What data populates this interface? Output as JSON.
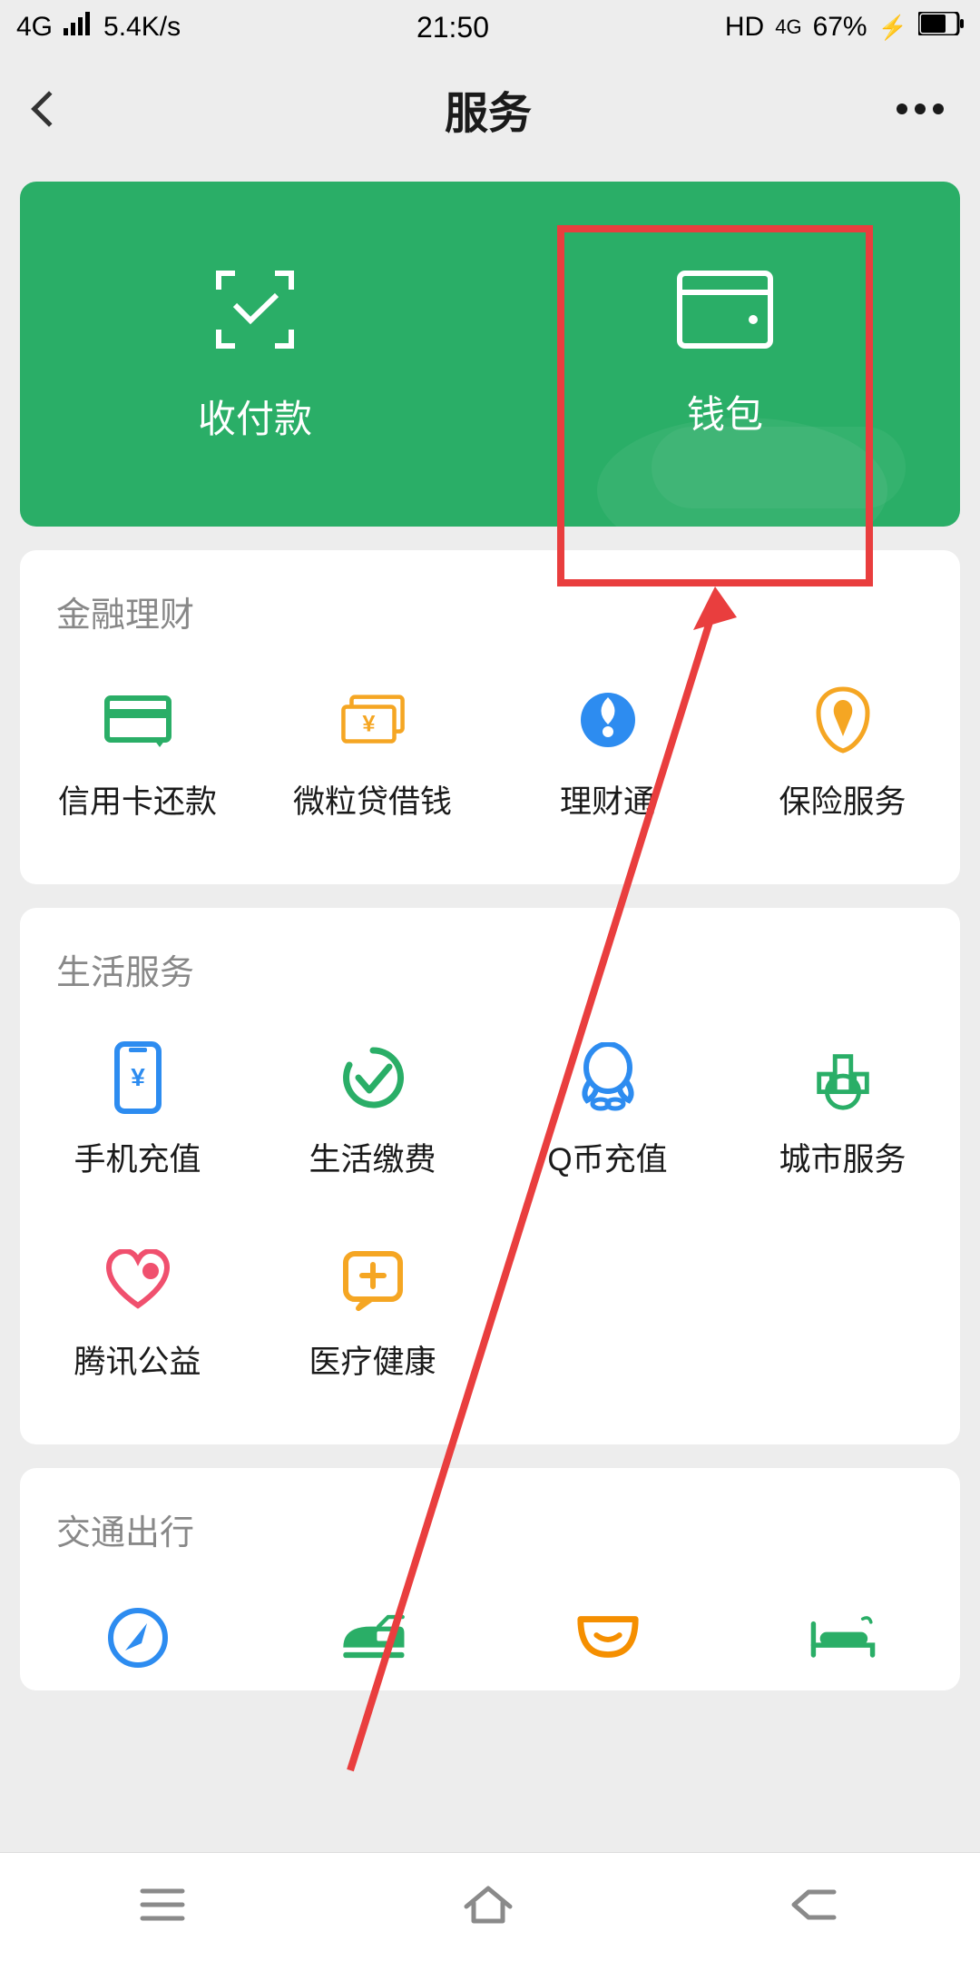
{
  "status": {
    "network": "4G",
    "speed": "5.4K/s",
    "time": "21:50",
    "hd": "HD",
    "net2": "4G",
    "battery": "67%"
  },
  "header": {
    "title": "服务"
  },
  "green": {
    "pay_label": "收付款",
    "wallet_label": "钱包"
  },
  "sections": [
    {
      "title": "金融理财",
      "items": [
        {
          "label": "信用卡还款",
          "icon": "credit-card-icon",
          "color": "#2aae67"
        },
        {
          "label": "微粒贷借钱",
          "icon": "cash-icon",
          "color": "#f5a623"
        },
        {
          "label": "理财通",
          "icon": "finance-icon",
          "color": "#2d8cf0"
        },
        {
          "label": "保险服务",
          "icon": "insurance-icon",
          "color": "#f5a623"
        }
      ]
    },
    {
      "title": "生活服务",
      "items": [
        {
          "label": "手机充值",
          "icon": "phone-topup-icon",
          "color": "#2d8cf0"
        },
        {
          "label": "生活缴费",
          "icon": "utilities-icon",
          "color": "#2aae67"
        },
        {
          "label": "Q币充值",
          "icon": "qq-coin-icon",
          "color": "#2d8cf0"
        },
        {
          "label": "城市服务",
          "icon": "city-service-icon",
          "color": "#2aae67"
        },
        {
          "label": "腾讯公益",
          "icon": "charity-icon",
          "color": "#f0506e"
        },
        {
          "label": "医疗健康",
          "icon": "health-icon",
          "color": "#f5a623"
        }
      ]
    },
    {
      "title": "交通出行",
      "items": [
        {
          "label": "",
          "icon": "compass-icon",
          "color": "#2d8cf0"
        },
        {
          "label": "",
          "icon": "train-icon",
          "color": "#2aae67"
        },
        {
          "label": "",
          "icon": "didi-icon",
          "color": "#f58f00"
        },
        {
          "label": "",
          "icon": "hotel-icon",
          "color": "#2aae67"
        }
      ]
    }
  ],
  "colors": {
    "accent_green": "#2aae67",
    "annotation_red": "#e93e3e"
  }
}
